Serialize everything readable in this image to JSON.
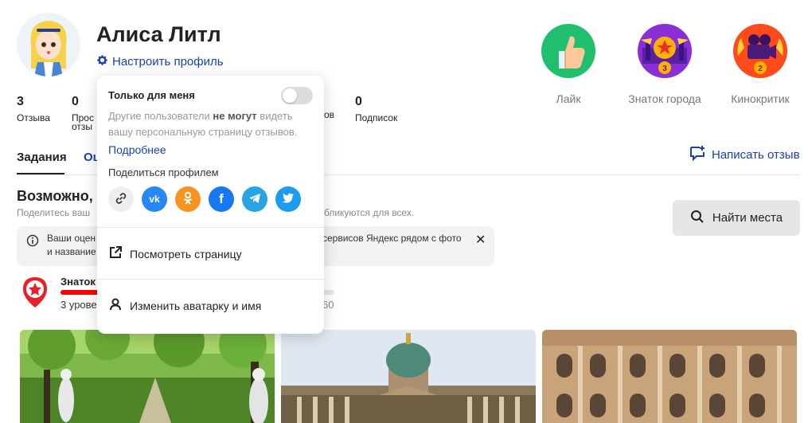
{
  "profile": {
    "name": "Алиса Литл",
    "settings_label": "Настроить профиль"
  },
  "stats": [
    {
      "value": "3",
      "label": "Отзыва"
    },
    {
      "value": "0",
      "label": "Прос"
    },
    {
      "label_cont": "отзы"
    },
    {
      "label_partial": "ов"
    },
    {
      "value": "0",
      "label": "Подписок"
    }
  ],
  "achievements": [
    {
      "label": "Лайк",
      "color": "#1fbf6e"
    },
    {
      "label": "Знаток города",
      "color": "#8a2fd6",
      "level": "3"
    },
    {
      "label": "Кинокритик",
      "color": "#ff4a1c",
      "level": "2"
    }
  ],
  "tabs": {
    "active": "Задания",
    "second": "Оц"
  },
  "write_review": "Написать отзыв",
  "possible": {
    "title": "Возможно,",
    "sub_a": "Поделитесь ваш",
    "sub_b": "бликуются для всех."
  },
  "find_places": "Найти места",
  "notice": {
    "line1": "Ваши оцен",
    "line1b": "сервисов Яндекс рядом с фото",
    "line2": "и название"
  },
  "expert": {
    "title": "Знаток",
    "level": "3 урове",
    "points": "60",
    "progress": 0.17
  },
  "popup": {
    "only_me": "Только для меня",
    "desc_a": "Другие пользователи",
    "desc_bold": "не могут",
    "desc_b": "видеть",
    "desc_line2": "вашу персональную страницу отзывов.",
    "more": "Подробнее",
    "share_title": "Поделиться профилем",
    "share": [
      {
        "name": "link",
        "color": "#eeeeee"
      },
      {
        "name": "vk",
        "color": "#2787f5",
        "glyph": "vk"
      },
      {
        "name": "ok",
        "color": "#f7931e",
        "glyph": "ok"
      },
      {
        "name": "facebook",
        "color": "#1877f2",
        "glyph": "f"
      },
      {
        "name": "telegram",
        "color": "#2aa3e2"
      },
      {
        "name": "twitter",
        "color": "#1d9bf0"
      }
    ],
    "view_page": "Посмотреть страницу",
    "edit_avatar": "Изменить аватарку и имя"
  }
}
